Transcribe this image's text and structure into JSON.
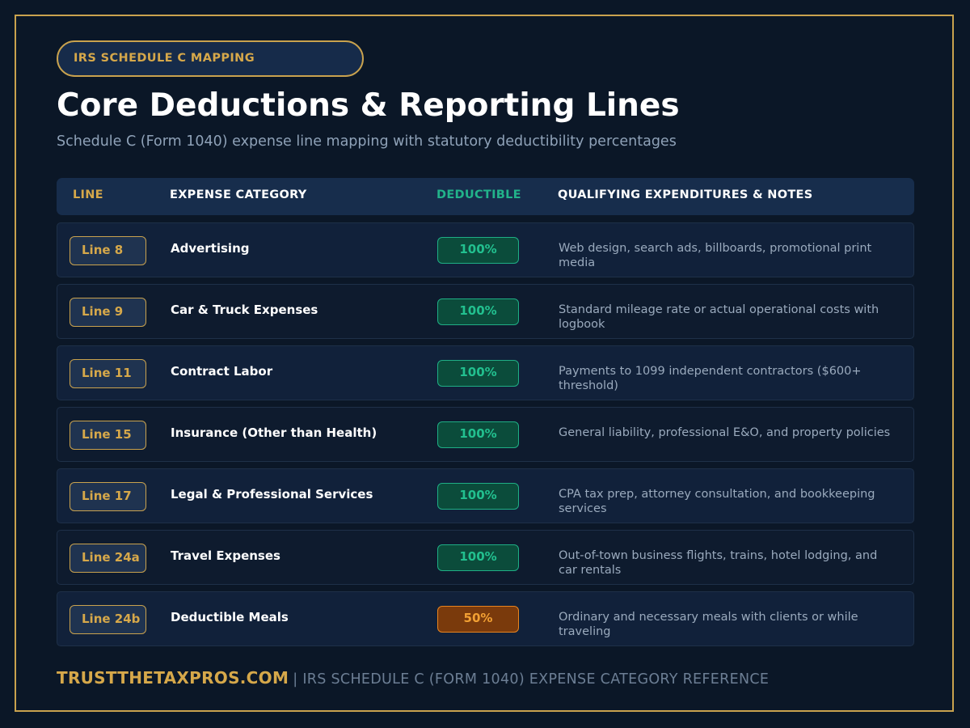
{
  "badge": "IRS SCHEDULE C MAPPING",
  "title": "Core Deductions & Reporting Lines",
  "subtitle": "Schedule C (Form 1040) expense line mapping with statutory deductibility percentages",
  "table": {
    "headers": {
      "line": "LINE",
      "category": "EXPENSE CATEGORY",
      "deductible": "DEDUCTIBLE",
      "notes": "QUALIFYING EXPENDITURES & NOTES"
    },
    "rows": [
      {
        "line": "Line 8",
        "category": "Advertising",
        "deductible": "100%",
        "notes": "Web design, search ads, billboards, promotional print media"
      },
      {
        "line": "Line 9",
        "category": "Car & Truck Expenses",
        "deductible": "100%",
        "notes": "Standard mileage rate or actual operational costs with logbook"
      },
      {
        "line": "Line 11",
        "category": "Contract Labor",
        "deductible": "100%",
        "notes": "Payments to 1099 independent contractors ($600+ threshold)"
      },
      {
        "line": "Line 15",
        "category": "Insurance (Other than Health)",
        "deductible": "100%",
        "notes": "General liability, professional E&O, and property policies"
      },
      {
        "line": "Line 17",
        "category": "Legal & Professional Services",
        "deductible": "100%",
        "notes": "CPA tax prep, attorney consultation, and bookkeeping services"
      },
      {
        "line": "Line 24a",
        "category": "Travel Expenses",
        "deductible": "100%",
        "notes": "Out-of-town business flights, trains, hotel lodging, and car rentals"
      },
      {
        "line": "Line 24b",
        "category": "Deductible Meals",
        "deductible": "50%",
        "notes": "Ordinary and necessary meals with clients or while traveling"
      }
    ]
  },
  "footer": {
    "brand": "TRUSTTHETAXPROS.COM",
    "note": "| IRS SCHEDULE C (FORM 1040) EXPENSE CATEGORY REFERENCE"
  },
  "colors": {
    "background": "#0b1727",
    "accent_gold": "#c9a24e",
    "deductible_full": "#22c08f",
    "deductible_partial": "#f2a033"
  }
}
